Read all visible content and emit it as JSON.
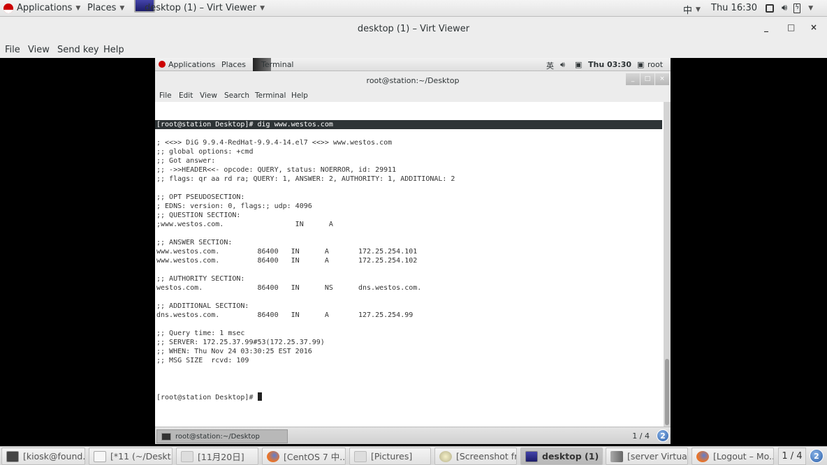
{
  "host_topbar": {
    "applications": "Applications",
    "places": "Places",
    "active_window": "desktop (1) – Virt Viewer",
    "input_method": "中",
    "clock": "Thu 16:30"
  },
  "viewer": {
    "title": "desktop (1) – Virt Viewer",
    "window_buttons": {
      "minimize": "_",
      "maximize": "□",
      "close": "×"
    },
    "menu": [
      "File",
      "View",
      "Send key",
      "Help"
    ]
  },
  "guest_topbar": {
    "applications": "Applications",
    "places": "Places",
    "active_window": "Terminal",
    "input_method": "英",
    "clock": "Thu 03:30",
    "user": "root"
  },
  "terminal": {
    "title": "root@station:~/Desktop",
    "window_buttons": {
      "minimize": "_",
      "maximize": "□",
      "close": "×"
    },
    "menu": [
      "File",
      "Edit",
      "View",
      "Search",
      "Terminal",
      "Help"
    ],
    "lines": [
      "[root@station Desktop]# dig www.westos.com",
      "",
      "; <<>> DiG 9.9.4-RedHat-9.9.4-14.el7 <<>> www.westos.com",
      ";; global options: +cmd",
      ";; Got answer:",
      ";; ->>HEADER<<- opcode: QUERY, status: NOERROR, id: 29911",
      ";; flags: qr aa rd ra; QUERY: 1, ANSWER: 2, AUTHORITY: 1, ADDITIONAL: 2",
      "",
      ";; OPT PSEUDOSECTION:",
      "; EDNS: version: 0, flags:; udp: 4096",
      ";; QUESTION SECTION:",
      ";www.westos.com.                 IN      A",
      "",
      ";; ANSWER SECTION:",
      "www.westos.com.         86400   IN      A       172.25.254.101",
      "www.westos.com.         86400   IN      A       172.25.254.102",
      "",
      ";; AUTHORITY SECTION:",
      "westos.com.             86400   IN      NS      dns.westos.com.",
      "",
      ";; ADDITIONAL SECTION:",
      "dns.westos.com.         86400   IN      A       127.25.254.99",
      "",
      ";; Query time: 1 msec",
      ";; SERVER: 172.25.37.99#53(172.25.37.99)",
      ";; WHEN: Thu Nov 24 03:30:25 EST 2016",
      ";; MSG SIZE  rcvd: 109",
      ""
    ],
    "prompt": "[root@station Desktop]# "
  },
  "guest_taskbar": {
    "task": "root@station:~/Desktop",
    "workspace": "1 / 4",
    "notifications": "2"
  },
  "host_taskbar": {
    "tasks": [
      {
        "label": "[kiosk@found...",
        "icon": "terminal-icon"
      },
      {
        "label": "[*11 (~/Deskt...",
        "icon": "text-editor-icon"
      },
      {
        "label": "[11月20日]",
        "icon": "file-manager-icon"
      },
      {
        "label": "[CentOS 7 中...",
        "icon": "firefox-icon"
      },
      {
        "label": "[Pictures]",
        "icon": "file-manager-icon"
      },
      {
        "label": "[Screenshot fr...",
        "icon": "screenshot-icon"
      },
      {
        "label": "desktop (1) – ...",
        "icon": "virt-viewer-icon",
        "active": true
      },
      {
        "label": "[server Virtual...",
        "icon": "virt-manager-icon"
      },
      {
        "label": "[Logout – Mo...",
        "icon": "firefox-icon"
      }
    ],
    "workspace": "1 / 4",
    "notifications": "2"
  }
}
